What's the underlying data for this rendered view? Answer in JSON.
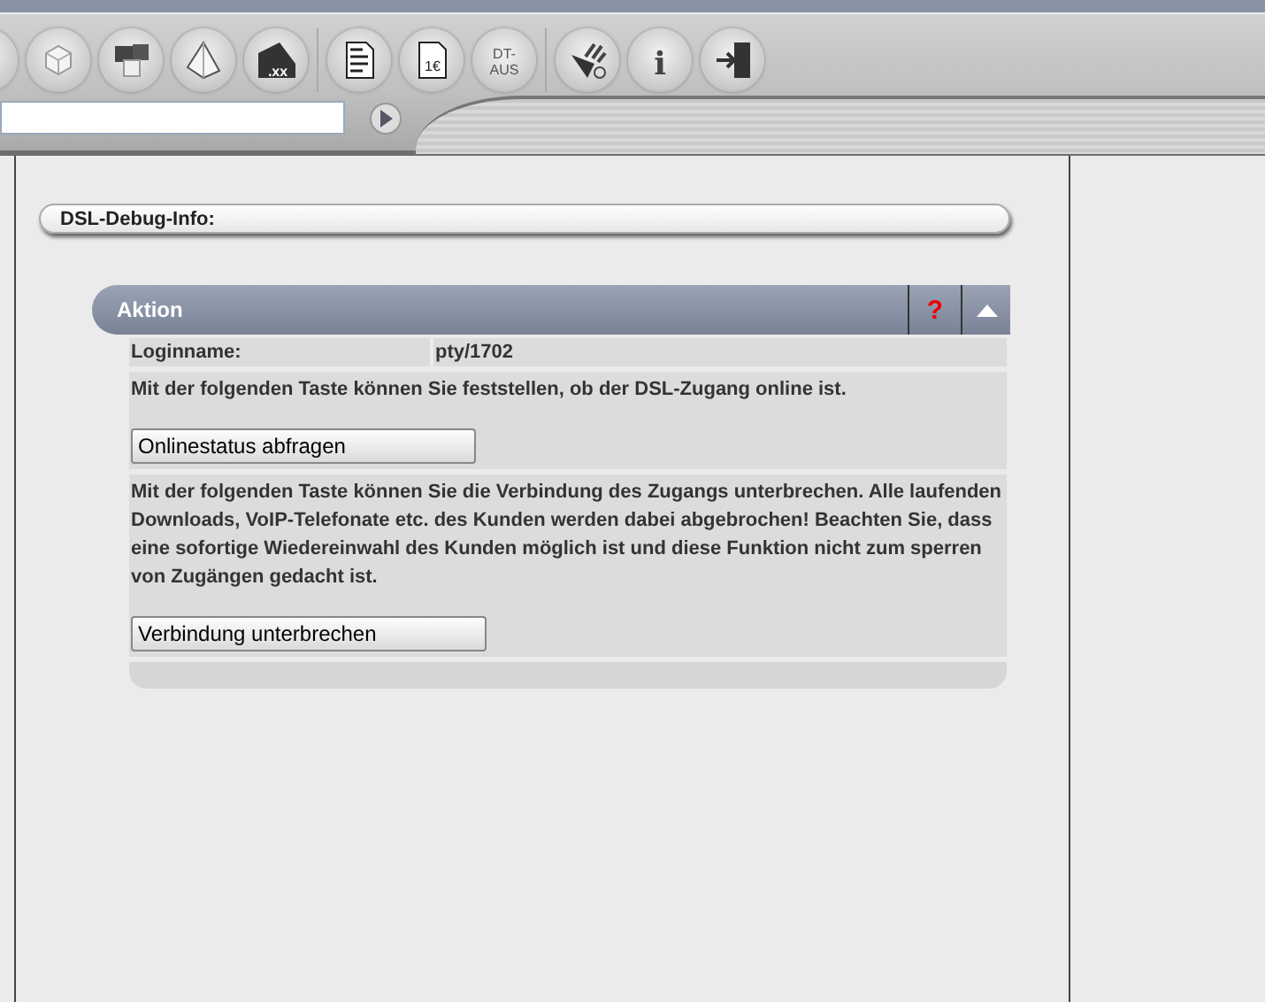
{
  "toolbar": {
    "groups": [
      [
        {
          "kind": "plain"
        },
        {
          "kind": "cube"
        },
        {
          "kind": "cubes"
        },
        {
          "kind": "pyramid"
        },
        {
          "kind": "extension",
          "label": ".xx"
        }
      ],
      [
        {
          "kind": "document"
        },
        {
          "kind": "invoice",
          "label": "1€"
        },
        {
          "kind": "text",
          "label": "DT-AUS"
        }
      ],
      [
        {
          "kind": "tools"
        },
        {
          "kind": "info",
          "label": "i"
        },
        {
          "kind": "exit"
        }
      ]
    ]
  },
  "section": {
    "title": "DSL-Debug-Info:"
  },
  "panel": {
    "title": "Aktion",
    "help": "?",
    "expanded": true,
    "login": {
      "label": "Loginname:",
      "value": "pty/1702"
    },
    "actions": [
      {
        "text": "Mit der folgenden Taste können Sie feststellen, ob der DSL-Zugang online ist.",
        "button": "Onlinestatus abfragen"
      },
      {
        "text": "Mit der folgenden Taste können Sie die Verbindung des Zugangs unterbrechen. Alle laufenden Downloads, VoIP-Telefonate etc. des Kunden werden dabei abgebrochen! Beachten Sie, dass eine sofortige Wiedereinwahl des Kunden möglich ist und diese Funktion nicht zum sperren von Zugängen gedacht ist.",
        "button": "Verbindung unterbrechen"
      }
    ]
  }
}
